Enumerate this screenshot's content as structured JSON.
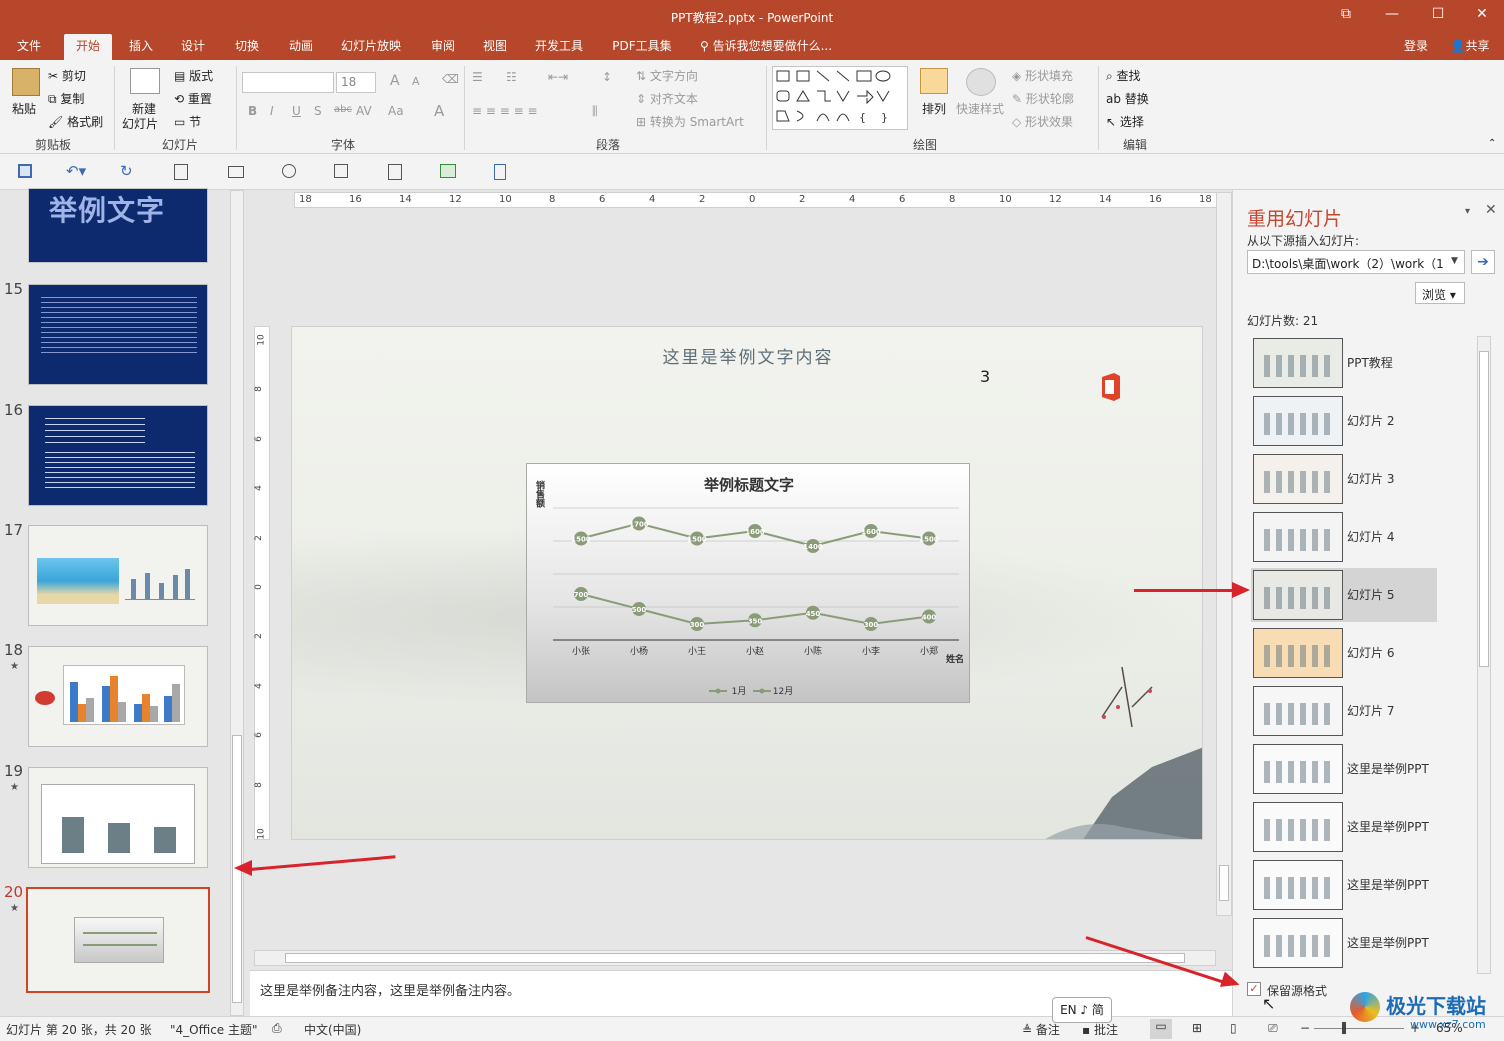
{
  "window": {
    "title": "PPT教程2.pptx - PowerPoint",
    "controls": [
      "⧉",
      "—",
      "☐",
      "✕"
    ]
  },
  "tabs": [
    "文件",
    "开始",
    "插入",
    "设计",
    "切换",
    "动画",
    "幻灯片放映",
    "审阅",
    "视图",
    "开发工具",
    "PDF工具集"
  ],
  "active_tab": "开始",
  "tellme": "告诉我您想要做什么...",
  "account": {
    "login": "登录",
    "share": "共享"
  },
  "ribbon": {
    "clipboard": {
      "paste": "粘贴",
      "cut": "剪切",
      "copy": "复制",
      "format_painter": "格式刷",
      "label": "剪贴板"
    },
    "slides": {
      "new_slide": "新建",
      "new_slide2": "幻灯片",
      "layout": "版式",
      "reset": "重置",
      "section": "节",
      "label": "幻灯片"
    },
    "font": {
      "font_size": "18",
      "label": "字体",
      "bold": "B",
      "italic": "I",
      "underline": "U",
      "shadow": "S",
      "strike": "abc",
      "spacing": "AV",
      "case": "Aa",
      "grow": "A",
      "shrink": "A",
      "color": "A"
    },
    "paragraph": {
      "text_direction": "文字方向",
      "align_text": "对齐文本",
      "smartart": "转换为 SmartArt",
      "label": "段落"
    },
    "drawing": {
      "arrange": "排列",
      "quick_styles": "快速样式",
      "shape_fill": "形状填充",
      "shape_outline": "形状轮廓",
      "shape_effects": "形状效果",
      "label": "绘图"
    },
    "editing": {
      "find": "查找",
      "replace": "替换",
      "select": "选择",
      "label": "编辑"
    }
  },
  "thumbnails": [
    {
      "num": "",
      "text": "举例文字",
      "star": false
    },
    {
      "num": "15",
      "star": false
    },
    {
      "num": "16",
      "star": false
    },
    {
      "num": "17",
      "star": false
    },
    {
      "num": "18",
      "star": true
    },
    {
      "num": "19",
      "star": true
    },
    {
      "num": "20",
      "star": true
    }
  ],
  "ruler_h": [
    "18",
    "16",
    "14",
    "12",
    "10",
    "8",
    "6",
    "4",
    "2",
    "0",
    "2",
    "4",
    "6",
    "8",
    "10",
    "12",
    "14",
    "16",
    "18"
  ],
  "ruler_v": [
    "10",
    "8",
    "6",
    "4",
    "2",
    "0",
    "2",
    "4",
    "6",
    "8",
    "10"
  ],
  "slide": {
    "heading": "这里是举例文字内容",
    "number": "3",
    "chart_data": {
      "type": "line",
      "title": "举例标题文字",
      "ylabel": "销售额",
      "xlabel": "姓名",
      "categories": [
        "小张",
        "小杨",
        "小王",
        "小赵",
        "小陈",
        "小李",
        "小郑"
      ],
      "series": [
        {
          "name": "1月",
          "values": [
            1500,
            1700,
            1500,
            1600,
            1400,
            1600,
            1500
          ]
        },
        {
          "name": "12月",
          "values": [
            700,
            500,
            300,
            350,
            450,
            300,
            400
          ]
        }
      ],
      "legend": "bottom",
      "grid": true
    }
  },
  "notes": "这里是举例备注内容，这里是举例备注内容。",
  "reuse": {
    "title": "重用幻灯片",
    "source_label": "从以下源插入幻灯片:",
    "source_path": "D:\\tools\\桌面\\work（2）\\work（1",
    "browse": "浏览",
    "count": "幻灯片数: 21",
    "items": [
      "PPT教程",
      "幻灯片 2",
      "幻灯片 3",
      "幻灯片 4",
      "幻灯片 5",
      "幻灯片 6",
      "幻灯片 7",
      "这里是举例PPT",
      "这里是举例PPT",
      "这里是举例PPT",
      "这里是举例PPT"
    ],
    "keep_format": "保留源格式"
  },
  "ime": "EN ♪ 简",
  "status": {
    "slide_info": "幻灯片 第 20 张，共 20 张",
    "theme": "\"4_Office 主题\"",
    "language": "中文(中国)",
    "notes": "备注",
    "comments": "批注",
    "zoom": "65%"
  },
  "watermark": "极光下载站",
  "watermark_url": "www.xz7.com",
  "colors": {
    "accent": "#b7472a",
    "series_line": "#8a9b78"
  }
}
